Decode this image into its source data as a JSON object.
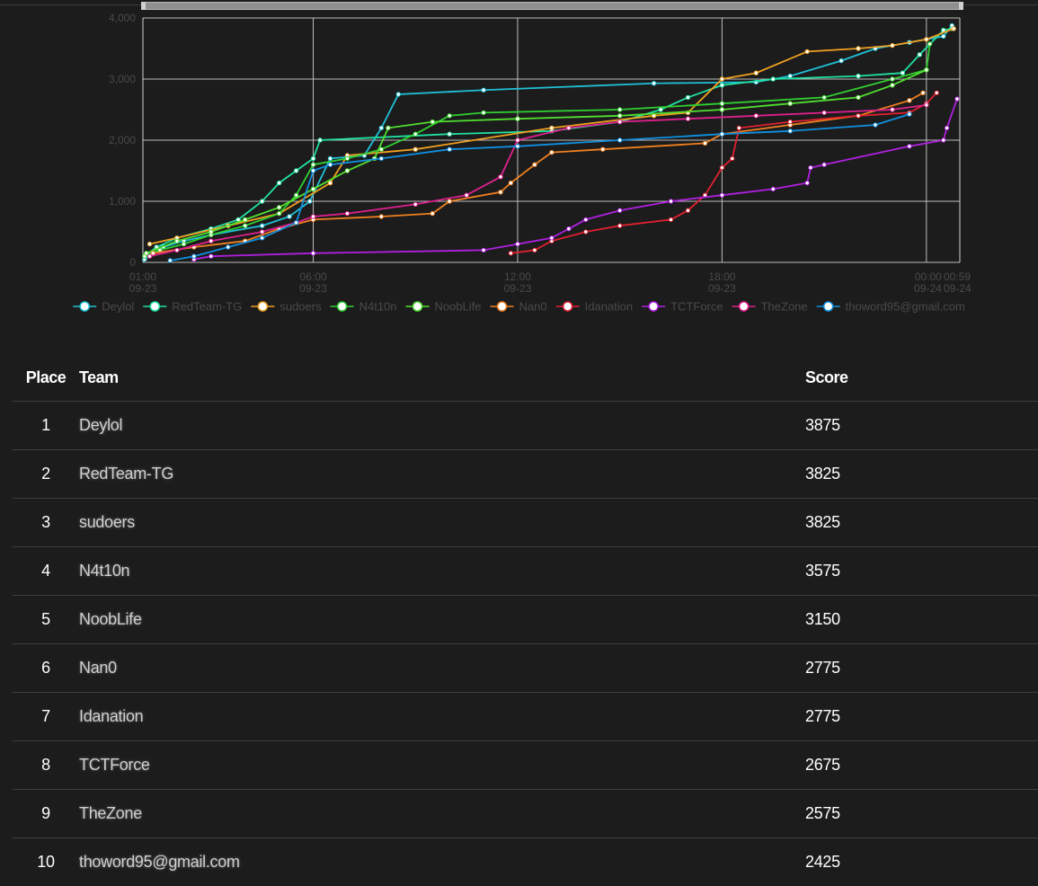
{
  "table": {
    "headers": {
      "place": "Place",
      "team": "Team",
      "score": "Score"
    },
    "rows": [
      {
        "place": "1",
        "team": "Deylol",
        "score": "3875"
      },
      {
        "place": "2",
        "team": "RedTeam-TG",
        "score": "3825"
      },
      {
        "place": "3",
        "team": "sudoers",
        "score": "3825"
      },
      {
        "place": "4",
        "team": "N4t10n",
        "score": "3575"
      },
      {
        "place": "5",
        "team": "NoobLife",
        "score": "3150"
      },
      {
        "place": "6",
        "team": "Nan0",
        "score": "2775"
      },
      {
        "place": "7",
        "team": "Idanation",
        "score": "2775"
      },
      {
        "place": "8",
        "team": "TCTForce",
        "score": "2675"
      },
      {
        "place": "9",
        "team": "TheZone",
        "score": "2575"
      },
      {
        "place": "10",
        "team": "thoword95@gmail.com",
        "score": "2425"
      }
    ]
  },
  "chart_data": {
    "type": "line",
    "x_ticks": [
      {
        "time": "01:00",
        "date": "09-23",
        "hour": 1
      },
      {
        "time": "06:00",
        "date": "09-23",
        "hour": 6
      },
      {
        "time": "12:00",
        "date": "09-23",
        "hour": 12
      },
      {
        "time": "18:00",
        "date": "09-23",
        "hour": 18
      },
      {
        "time": "00:00",
        "date": "09-24",
        "hour": 24
      },
      {
        "time": "00:59",
        "date": "09-24",
        "hour": 24.98
      }
    ],
    "xlim_hours": [
      1,
      24.98
    ],
    "ylim": [
      0,
      4000
    ],
    "y_ticks": [
      "0",
      "1,000",
      "2,000",
      "3,000",
      "4,000"
    ],
    "y_tick_values": [
      0,
      1000,
      2000,
      3000,
      4000
    ],
    "grid": true,
    "legend_position": "bottom",
    "series": [
      {
        "name": "Deylol",
        "color": "#20c0d8",
        "points": [
          [
            1.05,
            50
          ],
          [
            1.3,
            150
          ],
          [
            1.6,
            250
          ],
          [
            2.2,
            350
          ],
          [
            3.0,
            450
          ],
          [
            4.5,
            600
          ],
          [
            5.3,
            750
          ],
          [
            5.9,
            1000
          ],
          [
            6.5,
            1700
          ],
          [
            7.5,
            1750
          ],
          [
            8.0,
            2200
          ],
          [
            8.5,
            2750
          ],
          [
            11.0,
            2820
          ],
          [
            16.0,
            2930
          ],
          [
            19.0,
            2950
          ],
          [
            20.0,
            3050
          ],
          [
            21.5,
            3300
          ],
          [
            22.5,
            3500
          ],
          [
            23.5,
            3600
          ],
          [
            24.5,
            3700
          ],
          [
            24.75,
            3875
          ]
        ]
      },
      {
        "name": "RedTeam-TG",
        "color": "#20e0a0",
        "points": [
          [
            1.05,
            100
          ],
          [
            1.4,
            250
          ],
          [
            2.0,
            400
          ],
          [
            3.0,
            550
          ],
          [
            3.8,
            700
          ],
          [
            4.5,
            1000
          ],
          [
            5.0,
            1300
          ],
          [
            5.5,
            1500
          ],
          [
            6.0,
            1700
          ],
          [
            6.2,
            2000
          ],
          [
            10.0,
            2100
          ],
          [
            13.0,
            2150
          ],
          [
            15.0,
            2300
          ],
          [
            16.2,
            2500
          ],
          [
            17.0,
            2700
          ],
          [
            18.0,
            2900
          ],
          [
            19.5,
            3000
          ],
          [
            22.0,
            3050
          ],
          [
            23.3,
            3100
          ],
          [
            23.8,
            3400
          ],
          [
            24.5,
            3800
          ],
          [
            24.75,
            3825
          ]
        ]
      },
      {
        "name": "sudoers",
        "color": "#f0a020",
        "points": [
          [
            1.2,
            300
          ],
          [
            2.0,
            400
          ],
          [
            3.5,
            600
          ],
          [
            5.0,
            800
          ],
          [
            6.5,
            1300
          ],
          [
            7.0,
            1750
          ],
          [
            9.0,
            1850
          ],
          [
            13.0,
            2200
          ],
          [
            16.0,
            2400
          ],
          [
            17.0,
            2450
          ],
          [
            18.0,
            3000
          ],
          [
            19.0,
            3100
          ],
          [
            20.5,
            3450
          ],
          [
            22.0,
            3500
          ],
          [
            23.0,
            3550
          ],
          [
            24.0,
            3650
          ],
          [
            24.8,
            3825
          ]
        ]
      },
      {
        "name": "N4t10n",
        "color": "#30d030",
        "points": [
          [
            1.05,
            100
          ],
          [
            1.5,
            200
          ],
          [
            2.2,
            300
          ],
          [
            3.0,
            450
          ],
          [
            4.0,
            600
          ],
          [
            5.0,
            800
          ],
          [
            5.5,
            1100
          ],
          [
            6.0,
            1600
          ],
          [
            7.0,
            1700
          ],
          [
            8.0,
            1850
          ],
          [
            9.0,
            2100
          ],
          [
            10.0,
            2400
          ],
          [
            11.0,
            2450
          ],
          [
            15.0,
            2500
          ],
          [
            18.0,
            2600
          ],
          [
            21.0,
            2700
          ],
          [
            23.0,
            3000
          ],
          [
            24.0,
            3150
          ],
          [
            24.1,
            3575
          ]
        ]
      },
      {
        "name": "NoobLife",
        "color": "#50e030",
        "points": [
          [
            1.1,
            150
          ],
          [
            2.0,
            350
          ],
          [
            3.0,
            500
          ],
          [
            4.0,
            700
          ],
          [
            5.0,
            900
          ],
          [
            6.0,
            1200
          ],
          [
            7.0,
            1500
          ],
          [
            7.8,
            1700
          ],
          [
            8.2,
            2200
          ],
          [
            9.5,
            2300
          ],
          [
            12.0,
            2350
          ],
          [
            15.0,
            2400
          ],
          [
            18.0,
            2500
          ],
          [
            20.0,
            2600
          ],
          [
            22.0,
            2700
          ],
          [
            23.0,
            2900
          ],
          [
            24.0,
            3150
          ]
        ]
      },
      {
        "name": "Nan0",
        "color": "#f08020",
        "points": [
          [
            1.3,
            150
          ],
          [
            2.5,
            250
          ],
          [
            4.0,
            350
          ],
          [
            5.0,
            550
          ],
          [
            6.0,
            700
          ],
          [
            8.0,
            750
          ],
          [
            9.5,
            800
          ],
          [
            10.0,
            1000
          ],
          [
            11.5,
            1150
          ],
          [
            11.8,
            1300
          ],
          [
            12.5,
            1600
          ],
          [
            13.0,
            1800
          ],
          [
            14.5,
            1850
          ],
          [
            17.5,
            1950
          ],
          [
            18.0,
            2100
          ],
          [
            20.0,
            2250
          ],
          [
            22.0,
            2400
          ],
          [
            23.5,
            2650
          ],
          [
            23.9,
            2775
          ]
        ]
      },
      {
        "name": "Idanation",
        "color": "#e02030",
        "points": [
          [
            11.8,
            150
          ],
          [
            12.5,
            200
          ],
          [
            13.0,
            350
          ],
          [
            14.0,
            500
          ],
          [
            15.0,
            600
          ],
          [
            16.5,
            700
          ],
          [
            17.0,
            850
          ],
          [
            17.5,
            1100
          ],
          [
            18.0,
            1550
          ],
          [
            18.3,
            1700
          ],
          [
            18.5,
            2200
          ],
          [
            20.0,
            2300
          ],
          [
            22.0,
            2400
          ],
          [
            23.5,
            2450
          ],
          [
            24.0,
            2600
          ],
          [
            24.3,
            2775
          ]
        ]
      },
      {
        "name": "TCTForce",
        "color": "#b020e0",
        "points": [
          [
            2.5,
            50
          ],
          [
            3.0,
            100
          ],
          [
            6.0,
            150
          ],
          [
            11.0,
            200
          ],
          [
            12.0,
            300
          ],
          [
            13.0,
            400
          ],
          [
            13.5,
            550
          ],
          [
            14.0,
            700
          ],
          [
            15.0,
            850
          ],
          [
            16.5,
            1000
          ],
          [
            18.0,
            1100
          ],
          [
            19.5,
            1200
          ],
          [
            20.5,
            1300
          ],
          [
            20.6,
            1550
          ],
          [
            21.0,
            1600
          ],
          [
            23.5,
            1900
          ],
          [
            24.5,
            2000
          ],
          [
            24.6,
            2200
          ],
          [
            24.9,
            2675
          ]
        ]
      },
      {
        "name": "TheZone",
        "color": "#e0208f",
        "points": [
          [
            1.2,
            100
          ],
          [
            2.0,
            200
          ],
          [
            3.0,
            350
          ],
          [
            4.5,
            500
          ],
          [
            5.5,
            650
          ],
          [
            6.0,
            750
          ],
          [
            7.0,
            800
          ],
          [
            9.0,
            950
          ],
          [
            10.5,
            1100
          ],
          [
            11.5,
            1400
          ],
          [
            12.0,
            2000
          ],
          [
            13.5,
            2200
          ],
          [
            15.0,
            2300
          ],
          [
            17.0,
            2350
          ],
          [
            19.0,
            2400
          ],
          [
            21.0,
            2450
          ],
          [
            23.0,
            2500
          ],
          [
            24.0,
            2575
          ]
        ]
      },
      {
        "name": "thoword95@gmail.com",
        "color": "#1090e0",
        "points": [
          [
            1.8,
            30
          ],
          [
            2.5,
            100
          ],
          [
            3.5,
            250
          ],
          [
            4.5,
            400
          ],
          [
            5.5,
            650
          ],
          [
            6.0,
            1500
          ],
          [
            6.5,
            1600
          ],
          [
            8.0,
            1700
          ],
          [
            10.0,
            1850
          ],
          [
            12.0,
            1900
          ],
          [
            15.0,
            2000
          ],
          [
            18.0,
            2100
          ],
          [
            20.0,
            2150
          ],
          [
            22.5,
            2250
          ],
          [
            23.5,
            2425
          ]
        ]
      }
    ]
  }
}
